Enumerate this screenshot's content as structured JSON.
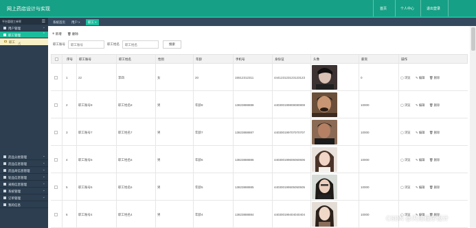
{
  "app": {
    "title": "网上药店设计与实现"
  },
  "topnav": {
    "home": "首页",
    "profile": "个人中心",
    "logout": "退出登录"
  },
  "sidebar": {
    "header": "平台管理工单率",
    "items": [
      {
        "label": "用户管理",
        "active": false
      },
      {
        "label": "职工管理",
        "active": true
      }
    ],
    "sub_item": "职工",
    "bottom_items": [
      {
        "label": "药品分类管理"
      },
      {
        "label": "药品信息管理"
      },
      {
        "label": "药品商信息管理"
      },
      {
        "label": "轮品信息管理"
      },
      {
        "label": "采购信息管理"
      },
      {
        "label": "系统管理"
      },
      {
        "label": "订单管理"
      },
      {
        "label": "我的信息"
      }
    ]
  },
  "tabs": [
    {
      "label": "系统首页",
      "closable": false,
      "active": false
    },
    {
      "label": "用户",
      "closable": true,
      "active": false
    },
    {
      "label": "职工",
      "closable": true,
      "active": true
    }
  ],
  "toolbar": {
    "add": "新增",
    "delete": "删除"
  },
  "filters": {
    "account_label": "职工账号",
    "account_placeholder": "职工账号",
    "name_label": "职工姓名",
    "name_placeholder": "职工姓名",
    "search": "搜索"
  },
  "table": {
    "columns": [
      "序号",
      "职工账号",
      "职工姓名",
      "性别",
      "年龄",
      "手机号",
      "身份证",
      "头像",
      "薪资",
      "操作"
    ],
    "actions": {
      "view": "浏览",
      "edit": "编辑",
      "delete": "删除"
    },
    "rows": [
      {
        "index": "1",
        "account": "22",
        "name": "李四",
        "gender": "女",
        "age": "20",
        "phone": "15512312311",
        "id_card": "444123123123123123",
        "salary": "0"
      },
      {
        "index": "2",
        "account": "职工账号8",
        "name": "职工姓名8",
        "gender": "男",
        "age": "年龄8",
        "phone": "13823888888",
        "id_card": "440300199808080808",
        "salary": "10000"
      },
      {
        "index": "3",
        "account": "职工账号7",
        "name": "职工姓名7",
        "gender": "男",
        "age": "年龄7",
        "phone": "13823888887",
        "id_card": "440300199707070707",
        "salary": "10000"
      },
      {
        "index": "4",
        "account": "职工账号6",
        "name": "职工姓名6",
        "gender": "男",
        "age": "年龄6",
        "phone": "13823888886",
        "id_card": "440300199606060606",
        "salary": "10000"
      },
      {
        "index": "5",
        "account": "职工账号5",
        "name": "职工姓名5",
        "gender": "男",
        "age": "年龄5",
        "phone": "13823888885",
        "id_card": "440300199505050505",
        "salary": "10000"
      },
      {
        "index": "6",
        "account": "职工账号4",
        "name": "职工姓名4",
        "gender": "男",
        "age": "年龄4",
        "phone": "13823888884",
        "id_card": "440300199404040404",
        "salary": "10000"
      }
    ]
  },
  "watermark": "CSDN @天成程序设计",
  "colors": {
    "brand": "#16a085",
    "accent": "#1abc9c",
    "sidebar": "#2c3e50",
    "tabbar": "#34495e"
  }
}
